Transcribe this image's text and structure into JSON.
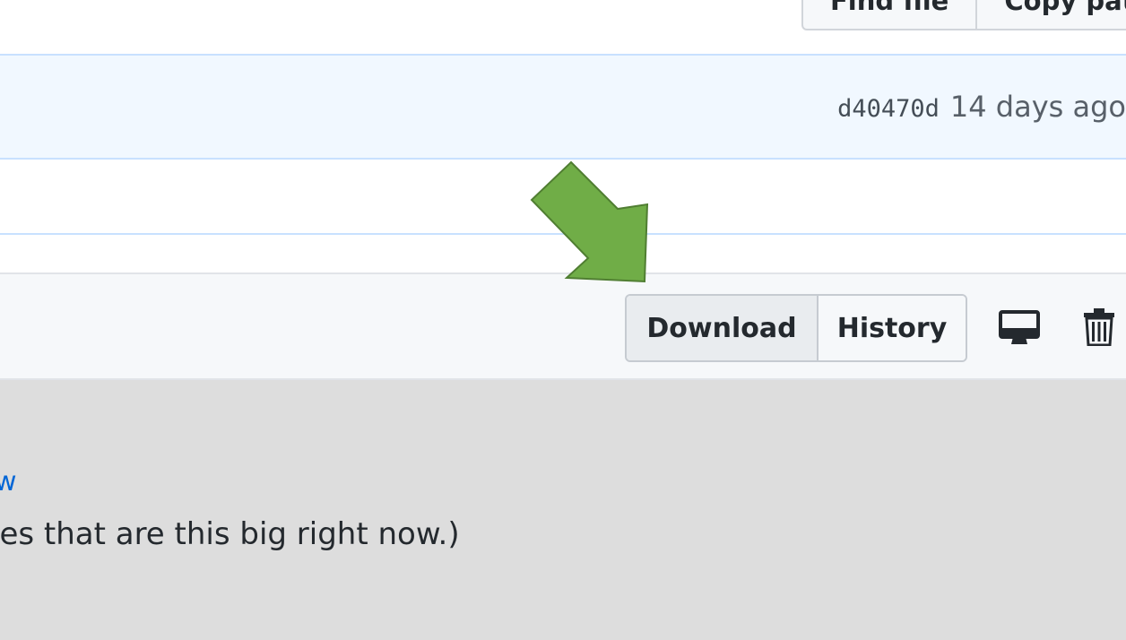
{
  "toolbar": {
    "find_file_label": "Find file",
    "copy_path_label": "Copy path"
  },
  "commit": {
    "sha": "d40470d",
    "age": "14 days ago"
  },
  "file_actions": {
    "download_label": "Download",
    "history_label": "History",
    "desktop_icon": "desktop-icon",
    "trash_icon": "trash-icon"
  },
  "blob": {
    "link_text": "w",
    "message_text": "les that are this big right now.)"
  },
  "annotation": {
    "arrow_color": "#70ad47",
    "arrow_stroke": "#507e32"
  }
}
